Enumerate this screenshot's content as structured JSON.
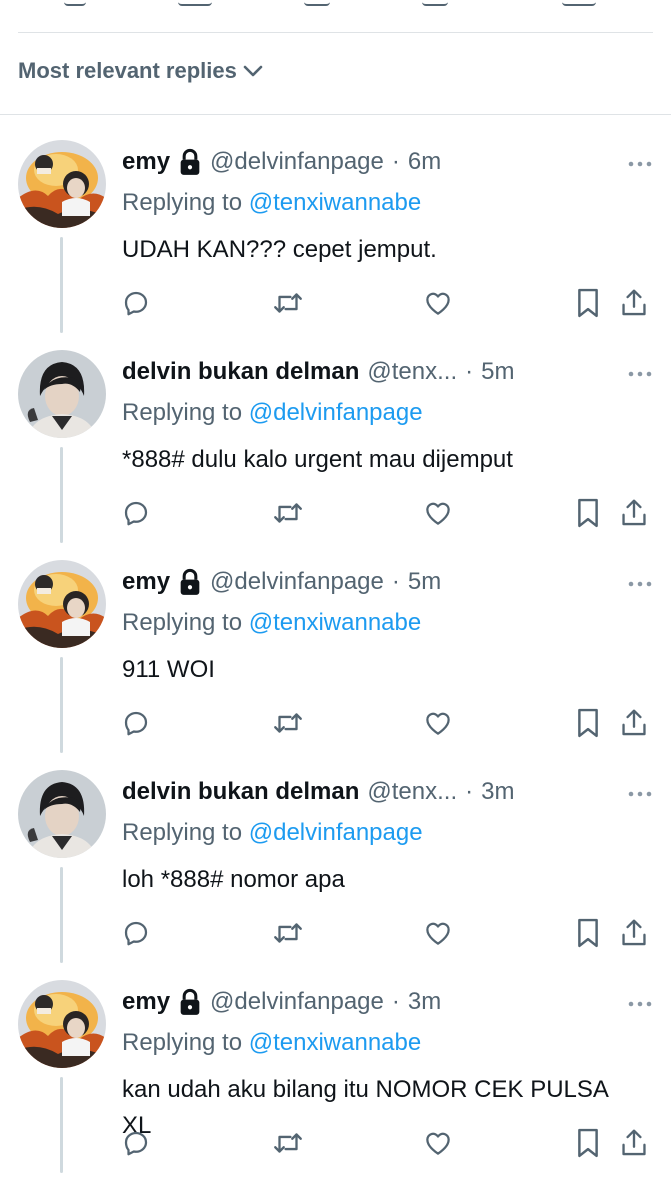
{
  "sort": {
    "label": "Most relevant replies"
  },
  "colors": {
    "text": "#0f1419",
    "secondary": "#536471",
    "accent": "#1d9bf0",
    "divider": "#dfe3e6",
    "thread": "#cfd9de"
  },
  "replies": [
    {
      "name": "emy",
      "protected": true,
      "handle": "@delvinfanpage",
      "sep": "·",
      "time": "6m",
      "replying_prefix": "Replying to",
      "replying_to": "@tenxiwannabe",
      "text": "UDAH KAN??? cepet jemput."
    },
    {
      "name": "delvin bukan delman",
      "protected": false,
      "handle": "@tenx...",
      "sep": "·",
      "time": "5m",
      "replying_prefix": "Replying to",
      "replying_to": "@delvinfanpage",
      "text": "*888# dulu kalo urgent mau dijemput"
    },
    {
      "name": "emy",
      "protected": true,
      "handle": "@delvinfanpage",
      "sep": "·",
      "time": "5m",
      "replying_prefix": "Replying to",
      "replying_to": "@tenxiwannabe",
      "text": "911 WOI"
    },
    {
      "name": "delvin bukan delman",
      "protected": false,
      "handle": "@tenx...",
      "sep": "·",
      "time": "3m",
      "replying_prefix": "Replying to",
      "replying_to": "@delvinfanpage",
      "text": "loh *888# nomor apa"
    },
    {
      "name": "emy",
      "protected": true,
      "handle": "@delvinfanpage",
      "sep": "·",
      "time": "3m",
      "replying_prefix": "Replying to",
      "replying_to": "@tenxiwannabe",
      "text": "kan udah aku bilang itu NOMOR CEK PULSA XL"
    }
  ],
  "icons": [
    "reply-icon",
    "retweet-icon",
    "like-icon",
    "bookmark-icon",
    "share-icon",
    "more-icon",
    "lock-icon",
    "chevron-down-icon"
  ]
}
